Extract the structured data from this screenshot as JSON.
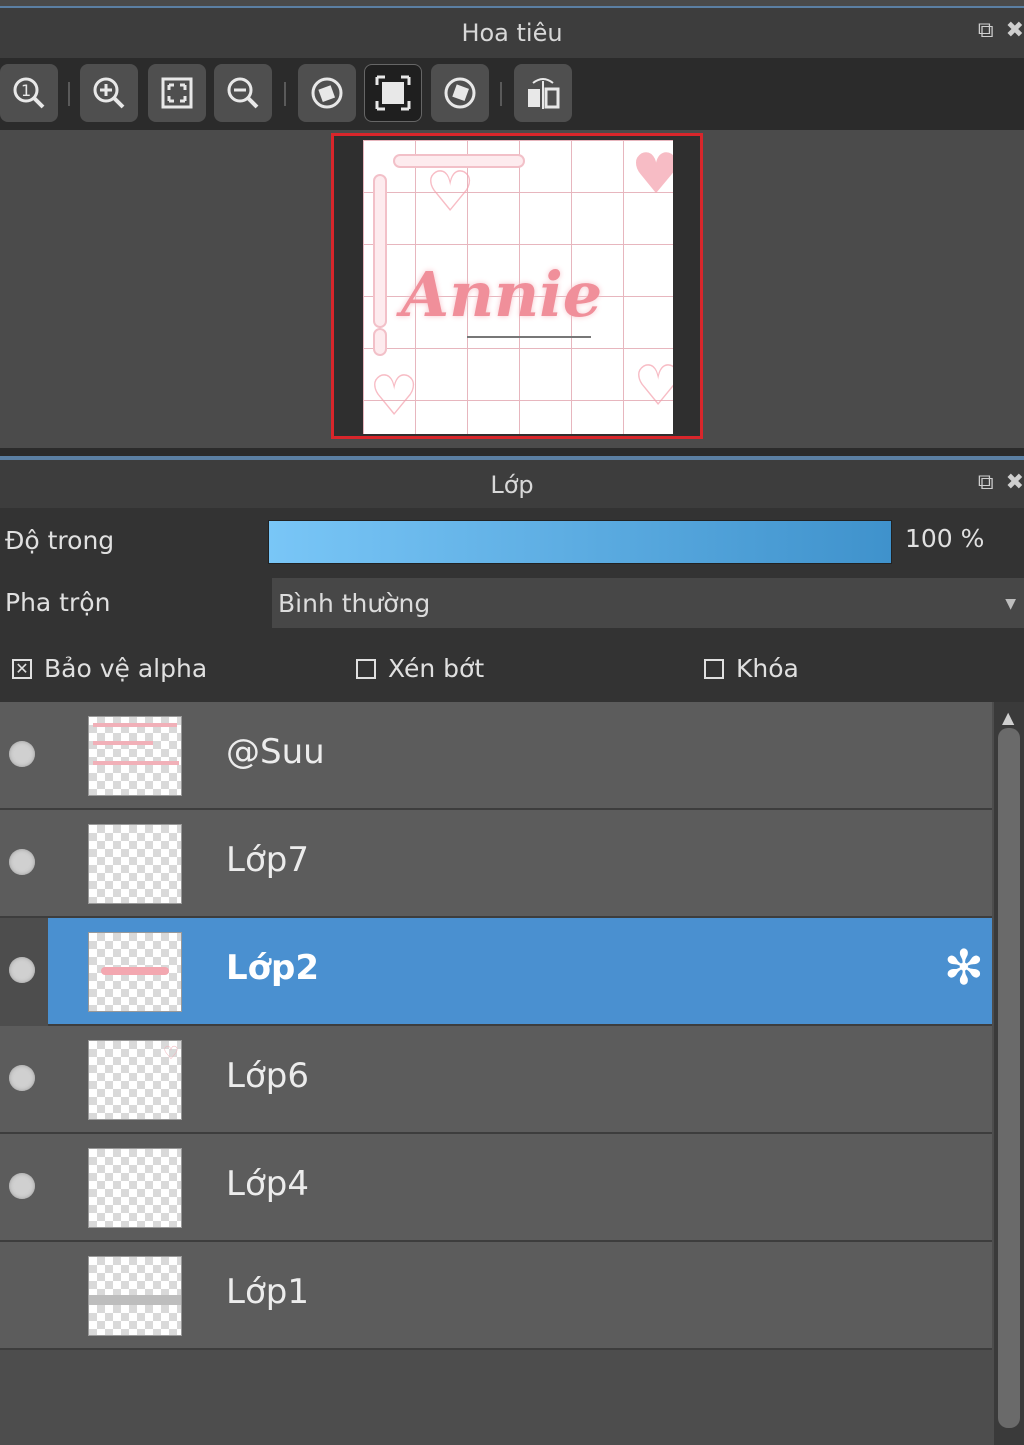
{
  "navigator": {
    "title": "Hoa tiêu",
    "toolbar": [
      {
        "icon": "zoom-actual-icon",
        "active": false
      },
      {
        "icon": "zoom-in-icon",
        "active": false
      },
      {
        "icon": "fit-screen-icon",
        "active": false
      },
      {
        "icon": "zoom-out-icon",
        "active": false
      },
      {
        "icon": "rotate-left-icon",
        "active": false
      },
      {
        "icon": "fit-frame-icon",
        "active": true
      },
      {
        "icon": "rotate-right-icon",
        "active": false
      },
      {
        "icon": "flip-horizontal-icon",
        "active": false
      }
    ],
    "canvas_text": "Annie"
  },
  "layers_panel": {
    "title": "Lớp",
    "opacity_label": "Độ trong",
    "opacity_value": "100 %",
    "opacity_fraction": 1.0,
    "blend_label": "Pha trộn",
    "blend_value": "Bình thường",
    "checkboxes": {
      "alpha": {
        "label": "Bảo vệ alpha",
        "checked": true
      },
      "clip": {
        "label": "Xén bớt",
        "checked": false
      },
      "lock": {
        "label": "Khóa",
        "checked": false
      }
    },
    "layers": [
      {
        "name": "@Suu",
        "visible": true,
        "selected": false
      },
      {
        "name": "Lớp7",
        "visible": true,
        "selected": false
      },
      {
        "name": "Lớp2",
        "visible": true,
        "selected": true
      },
      {
        "name": "Lớp6",
        "visible": true,
        "selected": false
      },
      {
        "name": "Lớp4",
        "visible": true,
        "selected": false
      },
      {
        "name": "Lớp1",
        "visible": false,
        "selected": false
      }
    ]
  }
}
